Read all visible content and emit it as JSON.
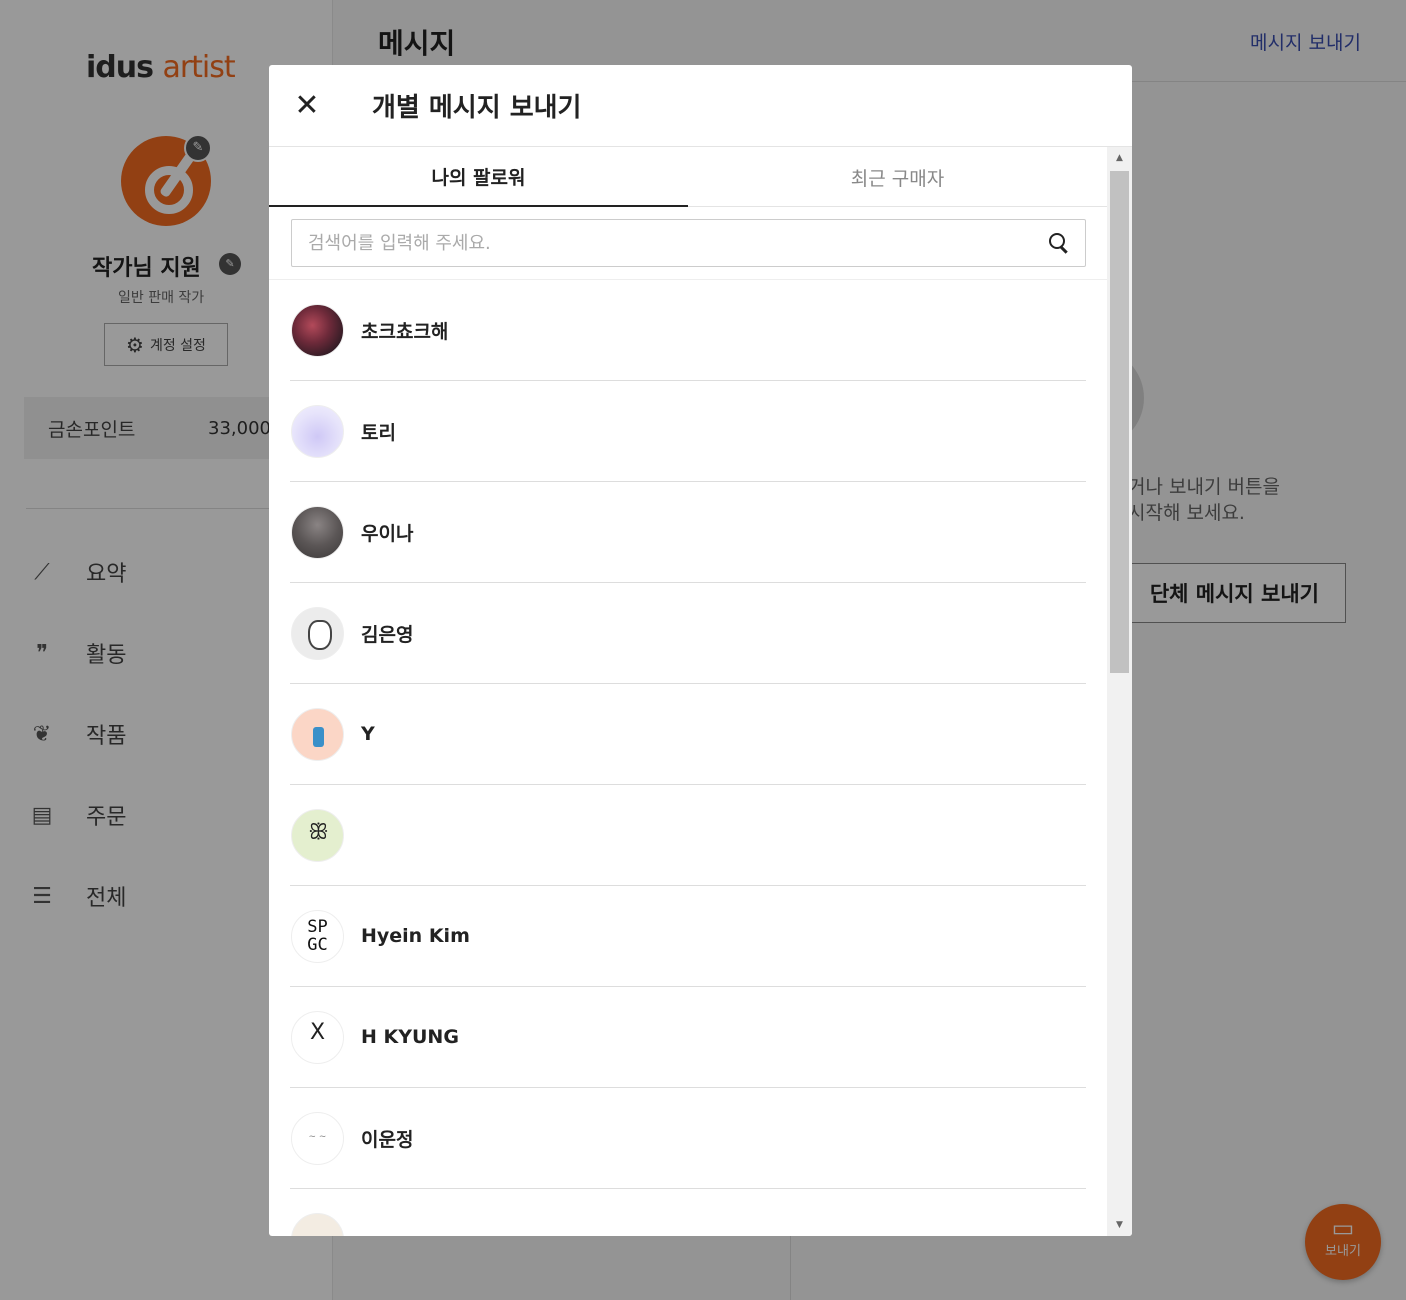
{
  "app": {
    "logo_text_1": "idus",
    "logo_text_2": "artist",
    "artist_name": "작가님 지원",
    "artist_type": "일반 판매 작가",
    "account_settings": "계정 설정",
    "points_label": "금손포인트",
    "points_value": "33,000",
    "nav": [
      {
        "label": "요약",
        "icon": "trending-up-icon"
      },
      {
        "label": "활동",
        "icon": "quote-icon"
      },
      {
        "label": "작품",
        "icon": "plant-icon"
      },
      {
        "label": "주문",
        "icon": "order-list-icon"
      },
      {
        "label": "전체",
        "icon": "menu-icon"
      }
    ]
  },
  "main": {
    "title": "메시지",
    "send_message_link": "메시지 보내기",
    "empty_line_1": "거나 보내기 버튼을",
    "empty_line_2": "시작해 보세요.",
    "group_message_button": "단체 메시지 보내기",
    "fab_label": "보내기"
  },
  "modal": {
    "title": "개별 메시지 보내기",
    "tabs": [
      {
        "label": "나의 팔로워",
        "active": true
      },
      {
        "label": "최근 구매자",
        "active": false
      }
    ],
    "search_placeholder": "검색어를 입력해 주세요.",
    "followers": [
      {
        "name": "초크쵸크해"
      },
      {
        "name": "토리"
      },
      {
        "name": "우이나"
      },
      {
        "name": "김은영"
      },
      {
        "name": "Y"
      },
      {
        "name": ""
      },
      {
        "name": "Hyein Kim",
        "avatar_text": "SP GC"
      },
      {
        "name": "H KYUNG",
        "avatar_text": "X"
      },
      {
        "name": "이운정"
      },
      {
        "name": ""
      }
    ]
  },
  "colors": {
    "accent": "#f36b21",
    "link": "#3a4db0"
  }
}
